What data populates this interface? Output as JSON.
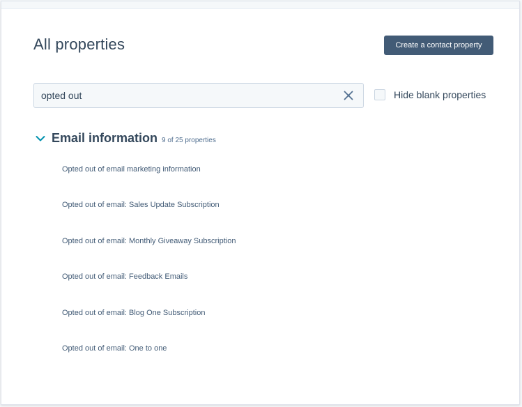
{
  "header": {
    "title": "All properties",
    "create_button_label": "Create a contact property"
  },
  "search": {
    "value": "opted out",
    "clear_icon": "close-icon"
  },
  "filters": {
    "hide_blank_label": "Hide blank properties",
    "hide_blank_checked": false
  },
  "section": {
    "title": "Email information",
    "count": "9 of 25 properties",
    "expanded": true,
    "items": [
      {
        "label": "Opted out of email marketing information"
      },
      {
        "label": "Opted out of email: Sales Update Subscription"
      },
      {
        "label": "Opted out of email: Monthly Giveaway Subscription"
      },
      {
        "label": "Opted out of email: Feedback Emails"
      },
      {
        "label": "Opted out of email: Blog One Subscription"
      },
      {
        "label": "Opted out of email: One to one"
      }
    ]
  },
  "colors": {
    "heading": "#33475b",
    "button_bg": "#425b76",
    "link": "#425b76",
    "chevron": "#0091ae"
  }
}
